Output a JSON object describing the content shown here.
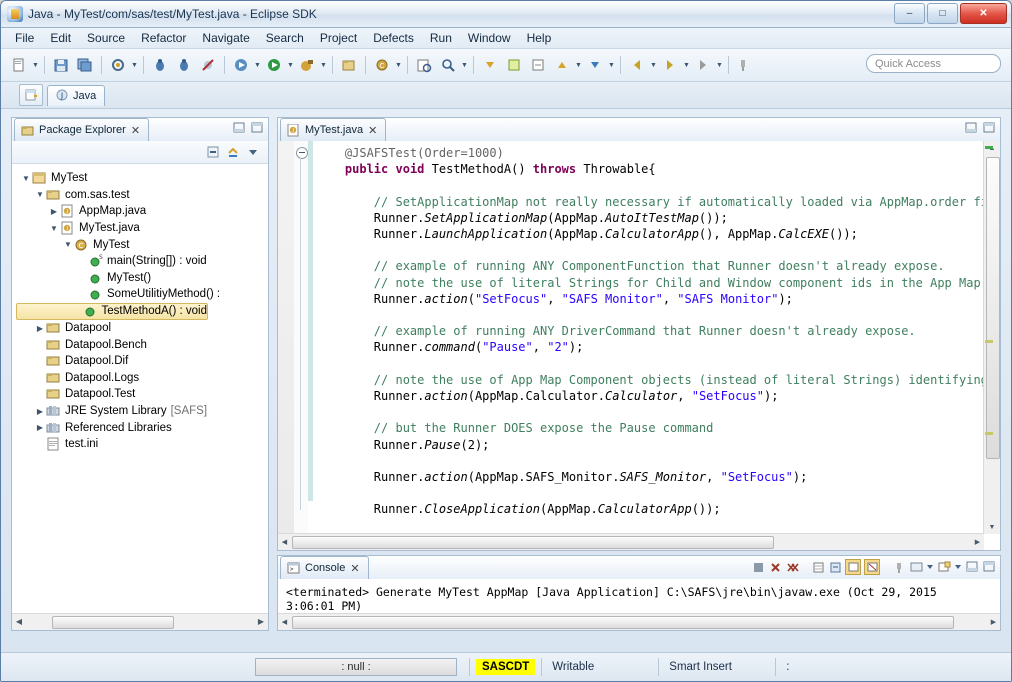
{
  "window": {
    "title": "Java - MyTest/com/sas/test/MyTest.java - Eclipse SDK",
    "minimize": "–",
    "maximize": "□",
    "close": "✕"
  },
  "menubar": [
    {
      "label": "File"
    },
    {
      "label": "Edit"
    },
    {
      "label": "Source"
    },
    {
      "label": "Refactor"
    },
    {
      "label": "Navigate"
    },
    {
      "label": "Search"
    },
    {
      "label": "Project"
    },
    {
      "label": "Defects"
    },
    {
      "label": "Run"
    },
    {
      "label": "Window"
    },
    {
      "label": "Help"
    }
  ],
  "toolbar": {
    "quick_access_placeholder": "Quick Access"
  },
  "perspective": {
    "open_perspective_tooltip": "Open Perspective",
    "tabs": [
      {
        "label": "Java"
      }
    ]
  },
  "package_explorer": {
    "tab_label": "Package Explorer",
    "tab_close": "✕",
    "tree": [
      {
        "indent": 0,
        "twist": "▼",
        "icon": "project-icon",
        "label": "MyTest",
        "suffix": ""
      },
      {
        "indent": 1,
        "twist": "▼",
        "icon": "package-icon",
        "label": "com.sas.test",
        "suffix": ""
      },
      {
        "indent": 2,
        "twist": "▶",
        "icon": "java-file-icon",
        "label": "AppMap.java",
        "suffix": ""
      },
      {
        "indent": 2,
        "twist": "▼",
        "icon": "java-file-icon",
        "label": "MyTest.java",
        "suffix": ""
      },
      {
        "indent": 3,
        "twist": "▼",
        "icon": "class-icon",
        "label": "MyTest",
        "suffix": ""
      },
      {
        "indent": 4,
        "twist": "",
        "icon": "method-public-static-icon",
        "label": "main(String[]) : void",
        "suffix": ""
      },
      {
        "indent": 4,
        "twist": "",
        "icon": "method-public-icon",
        "label": "MyTest()",
        "suffix": ""
      },
      {
        "indent": 4,
        "twist": "",
        "icon": "method-public-icon",
        "label": "SomeUtilitiyMethod() :",
        "suffix": ""
      },
      {
        "indent": 4,
        "twist": "",
        "icon": "method-public-icon",
        "label": "TestMethodA() : void",
        "suffix": "",
        "selected": true
      },
      {
        "indent": 1,
        "twist": "▶",
        "icon": "package-icon",
        "label": "Datapool",
        "suffix": ""
      },
      {
        "indent": 1,
        "twist": "",
        "icon": "package-icon",
        "label": "Datapool.Bench",
        "suffix": ""
      },
      {
        "indent": 1,
        "twist": "",
        "icon": "package-icon",
        "label": "Datapool.Dif",
        "suffix": ""
      },
      {
        "indent": 1,
        "twist": "",
        "icon": "package-icon",
        "label": "Datapool.Logs",
        "suffix": ""
      },
      {
        "indent": 1,
        "twist": "",
        "icon": "package-icon",
        "label": "Datapool.Test",
        "suffix": ""
      },
      {
        "indent": 1,
        "twist": "▶",
        "icon": "library-icon",
        "label": "JRE System Library",
        "suffix": "[SAFS]"
      },
      {
        "indent": 1,
        "twist": "▶",
        "icon": "library-icon",
        "label": "Referenced Libraries",
        "suffix": ""
      },
      {
        "indent": 1,
        "twist": "",
        "icon": "file-icon",
        "label": "test.ini",
        "suffix": ""
      }
    ]
  },
  "editor": {
    "tab_label": "MyTest.java",
    "tab_close": "✕",
    "code_lines": [
      {
        "segments": [
          {
            "t": "    ",
            "c": ""
          },
          {
            "t": "@JSAFSTest(Order=1000)",
            "c": "annot"
          }
        ]
      },
      {
        "segments": [
          {
            "t": "    ",
            "c": ""
          },
          {
            "t": "public",
            "c": "kw"
          },
          {
            "t": " ",
            "c": ""
          },
          {
            "t": "void",
            "c": "kw"
          },
          {
            "t": " TestMethodA() ",
            "c": ""
          },
          {
            "t": "throws",
            "c": "kw"
          },
          {
            "t": " Throwable{",
            "c": ""
          }
        ]
      },
      {
        "segments": [
          {
            "t": "",
            "c": ""
          }
        ]
      },
      {
        "segments": [
          {
            "t": "        ",
            "c": ""
          },
          {
            "t": "// SetApplicationMap not really necessary if automatically loaded via AppMap.order fi",
            "c": "cmt"
          }
        ]
      },
      {
        "segments": [
          {
            "t": "        Runner.",
            "c": ""
          },
          {
            "t": "SetApplicationMap",
            "c": "ital"
          },
          {
            "t": "(AppMap.",
            "c": ""
          },
          {
            "t": "AutoItTestMap",
            "c": "ital"
          },
          {
            "t": "());",
            "c": ""
          }
        ]
      },
      {
        "segments": [
          {
            "t": "        Runner.",
            "c": ""
          },
          {
            "t": "LaunchApplication",
            "c": "ital"
          },
          {
            "t": "(AppMap.",
            "c": ""
          },
          {
            "t": "CalculatorApp",
            "c": "ital"
          },
          {
            "t": "(), AppMap.",
            "c": ""
          },
          {
            "t": "CalcEXE",
            "c": "ital"
          },
          {
            "t": "());",
            "c": ""
          }
        ]
      },
      {
        "segments": [
          {
            "t": "",
            "c": ""
          }
        ]
      },
      {
        "segments": [
          {
            "t": "        ",
            "c": ""
          },
          {
            "t": "// example of running ANY ComponentFunction that Runner doesn't already expose.",
            "c": "cmt"
          }
        ]
      },
      {
        "segments": [
          {
            "t": "        ",
            "c": ""
          },
          {
            "t": "// note the use of literal Strings for Child and Window component ids in the App Map",
            "c": "cmt"
          }
        ]
      },
      {
        "segments": [
          {
            "t": "        Runner.",
            "c": ""
          },
          {
            "t": "action",
            "c": "ital"
          },
          {
            "t": "(",
            "c": ""
          },
          {
            "t": "\"SetFocus\"",
            "c": "str"
          },
          {
            "t": ", ",
            "c": ""
          },
          {
            "t": "\"SAFS Monitor\"",
            "c": "str"
          },
          {
            "t": ", ",
            "c": ""
          },
          {
            "t": "\"SAFS Monitor\"",
            "c": "str"
          },
          {
            "t": ");",
            "c": ""
          }
        ]
      },
      {
        "segments": [
          {
            "t": "",
            "c": ""
          }
        ]
      },
      {
        "segments": [
          {
            "t": "        ",
            "c": ""
          },
          {
            "t": "// example of running ANY DriverCommand that Runner doesn't already expose.",
            "c": "cmt"
          }
        ]
      },
      {
        "segments": [
          {
            "t": "        Runner.",
            "c": ""
          },
          {
            "t": "command",
            "c": "ital"
          },
          {
            "t": "(",
            "c": ""
          },
          {
            "t": "\"Pause\"",
            "c": "str"
          },
          {
            "t": ", ",
            "c": ""
          },
          {
            "t": "\"2\"",
            "c": "str"
          },
          {
            "t": ");",
            "c": ""
          }
        ]
      },
      {
        "segments": [
          {
            "t": "",
            "c": ""
          }
        ]
      },
      {
        "segments": [
          {
            "t": "        ",
            "c": ""
          },
          {
            "t": "// note the use of App Map Component objects (instead of literal Strings) identifying",
            "c": "cmt"
          }
        ]
      },
      {
        "segments": [
          {
            "t": "        Runner.",
            "c": ""
          },
          {
            "t": "action",
            "c": "ital"
          },
          {
            "t": "(AppMap.Calculator.",
            "c": ""
          },
          {
            "t": "Calculator",
            "c": "ital"
          },
          {
            "t": ", ",
            "c": ""
          },
          {
            "t": "\"SetFocus\"",
            "c": "str"
          },
          {
            "t": ");",
            "c": ""
          }
        ]
      },
      {
        "segments": [
          {
            "t": "",
            "c": ""
          }
        ]
      },
      {
        "segments": [
          {
            "t": "        ",
            "c": ""
          },
          {
            "t": "// but the Runner DOES expose the Pause command",
            "c": "cmt"
          }
        ]
      },
      {
        "segments": [
          {
            "t": "        Runner.",
            "c": ""
          },
          {
            "t": "Pause",
            "c": "ital"
          },
          {
            "t": "(2);",
            "c": ""
          }
        ]
      },
      {
        "segments": [
          {
            "t": "",
            "c": ""
          }
        ]
      },
      {
        "segments": [
          {
            "t": "        Runner.",
            "c": ""
          },
          {
            "t": "action",
            "c": "ital"
          },
          {
            "t": "(AppMap.SAFS_Monitor.",
            "c": ""
          },
          {
            "t": "SAFS_Monitor",
            "c": "ital"
          },
          {
            "t": ", ",
            "c": ""
          },
          {
            "t": "\"SetFocus\"",
            "c": "str"
          },
          {
            "t": ");",
            "c": ""
          }
        ]
      },
      {
        "segments": [
          {
            "t": "",
            "c": ""
          }
        ]
      },
      {
        "segments": [
          {
            "t": "        Runner.",
            "c": ""
          },
          {
            "t": "CloseApplication",
            "c": "ital"
          },
          {
            "t": "(AppMap.",
            "c": ""
          },
          {
            "t": "CalculatorApp",
            "c": "ital"
          },
          {
            "t": "());",
            "c": ""
          }
        ]
      },
      {
        "segments": [
          {
            "t": "",
            "c": ""
          }
        ]
      },
      {
        "segments": [
          {
            "t": "    }",
            "c": ""
          }
        ]
      }
    ]
  },
  "console": {
    "tab_label": "Console",
    "tab_close": "✕",
    "output": "<terminated> Generate MyTest AppMap [Java Application] C:\\SAFS\\jre\\bin\\javaw.exe (Oct 29, 2015 3:06:01 PM)"
  },
  "statusbar": {
    "selection": ": null :",
    "tool": "SASCDT",
    "writable": "Writable",
    "insert_mode": "Smart Insert",
    "position": ":"
  },
  "colors": {
    "accent": "#3a6ea5",
    "keyword": "#7f0055",
    "comment": "#3f7f5f",
    "string": "#2a00ff",
    "selection": "#f6e4a4",
    "highlight": "#ffff00"
  }
}
